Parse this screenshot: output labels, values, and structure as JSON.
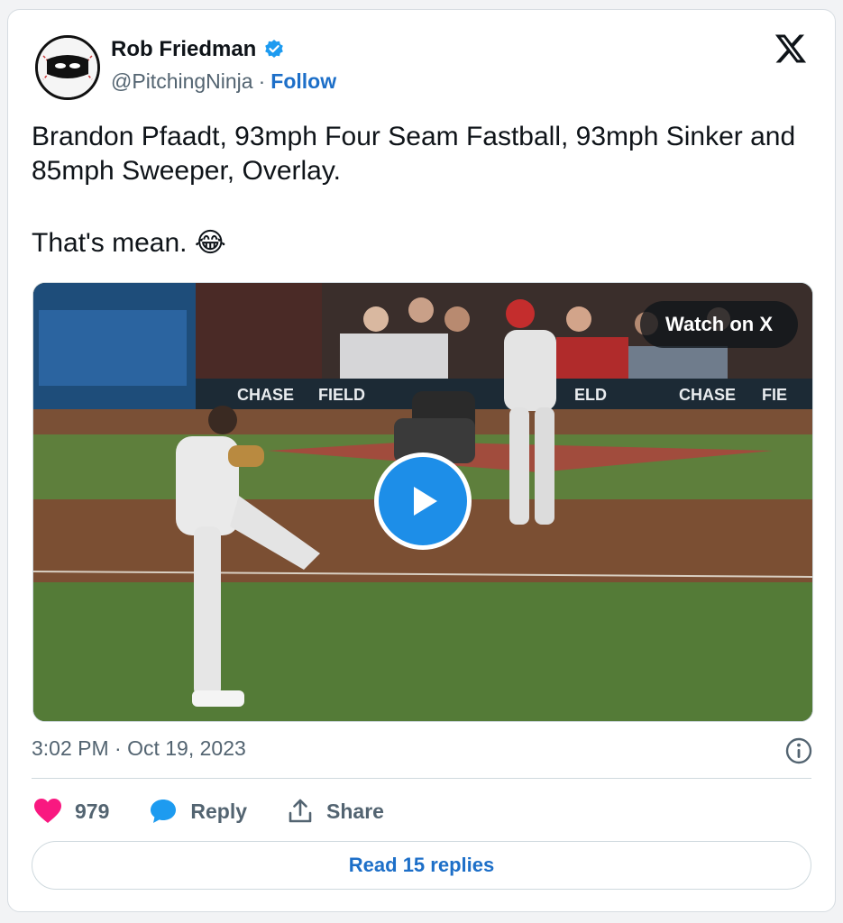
{
  "author": {
    "name": "Rob Friedman",
    "handle": "@PitchingNinja",
    "separator": "·",
    "follow_label": "Follow",
    "verified": true
  },
  "tweet": {
    "line1": "Brandon Pfaadt, 93mph Four Seam Fastball, 93mph Sinker and 85mph Sweeper, Overlay.",
    "line2": "That's mean. 😂"
  },
  "media": {
    "watch_label": "Watch on X",
    "signage": [
      "CHASE",
      "FIELD",
      "ELD",
      "CHASE",
      "FIE"
    ]
  },
  "timestamp": "3:02 PM · Oct 19, 2023",
  "actions": {
    "likes_count": "979",
    "reply_label": "Reply",
    "share_label": "Share"
  },
  "read_replies_label": "Read 15 replies",
  "colors": {
    "accent": "#1d6fc8",
    "heart": "#f91880",
    "reply_bubble": "#1d9bf0",
    "muted_text": "#536471",
    "play_button": "#1d8ee8"
  },
  "icons": [
    "verified-badge-icon",
    "x-logo-icon",
    "play-icon",
    "info-icon",
    "heart-icon",
    "reply-bubble-icon",
    "share-icon"
  ]
}
